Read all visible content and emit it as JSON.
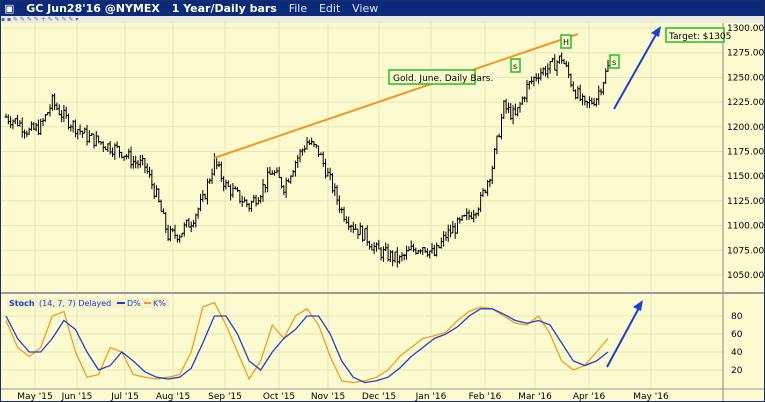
{
  "header": {
    "symbol": "GC Jun28'16 @NYMEX",
    "interval": "1 Year/Daily bars",
    "menus": [
      "File",
      "Edit",
      "View"
    ]
  },
  "annotations": {
    "label": "Gold. June. Daily Bars.",
    "target": "Target: $1305",
    "s1": "s",
    "h": "H",
    "s2": "s"
  },
  "colors": {
    "trend": "#f7941d",
    "arrow": "#1a3fd6",
    "box": "#1fbf1f",
    "k": "#f39c1f",
    "d": "#1d3fcf"
  },
  "chart_data": [
    {
      "type": "bar",
      "title": "Gold June Daily Bars",
      "ylim": [
        1040,
        1310
      ],
      "yticks": [
        "1300.00",
        "1275.00",
        "1250.00",
        "1225.00",
        "1200.00",
        "1175.00",
        "1150.00",
        "1125.00",
        "1100.00",
        "1075.00",
        "1050.00"
      ],
      "weekly_closes": [
        1210,
        1205,
        1195,
        1200,
        1225,
        1210,
        1200,
        1190,
        1185,
        1180,
        1175,
        1165,
        1160,
        1130,
        1090,
        1092,
        1105,
        1125,
        1165,
        1140,
        1130,
        1120,
        1135,
        1155,
        1140,
        1165,
        1185,
        1175,
        1145,
        1115,
        1100,
        1090,
        1075,
        1070,
        1065,
        1075,
        1080,
        1070,
        1090,
        1100,
        1110,
        1125,
        1160,
        1220,
        1210,
        1240,
        1255,
        1260,
        1270,
        1240,
        1220,
        1230,
        1260
      ]
    },
    {
      "type": "line",
      "title": "Stoch",
      "params": "(14, 7, 7) Delayed",
      "legend": [
        "D%",
        "K%"
      ],
      "ylim": [
        0,
        100
      ],
      "yticks": [
        "80",
        "60",
        "40",
        "20"
      ],
      "K": [
        75,
        45,
        35,
        45,
        80,
        85,
        40,
        12,
        15,
        45,
        40,
        15,
        12,
        10,
        12,
        15,
        40,
        90,
        95,
        70,
        40,
        10,
        30,
        70,
        55,
        80,
        88,
        70,
        35,
        8,
        6,
        8,
        12,
        20,
        35,
        45,
        55,
        58,
        62,
        75,
        85,
        90,
        88,
        80,
        72,
        70,
        80,
        60,
        30,
        20,
        25,
        40,
        55
      ],
      "D": [
        80,
        55,
        40,
        40,
        55,
        75,
        65,
        40,
        20,
        25,
        40,
        30,
        18,
        12,
        10,
        12,
        22,
        50,
        80,
        80,
        60,
        30,
        20,
        40,
        55,
        65,
        80,
        80,
        60,
        30,
        12,
        6,
        8,
        12,
        22,
        35,
        45,
        55,
        60,
        68,
        80,
        88,
        88,
        82,
        75,
        72,
        75,
        70,
        50,
        30,
        25,
        30,
        40
      ]
    }
  ],
  "xaxis": [
    "May '15",
    "Jun '15",
    "Jul '15",
    "Aug '15",
    "Sep '15",
    "Oct '15",
    "Nov '15",
    "Dec '15",
    "Jan '16",
    "Feb '16",
    "Mar '16",
    "Apr '16",
    "May '16"
  ]
}
